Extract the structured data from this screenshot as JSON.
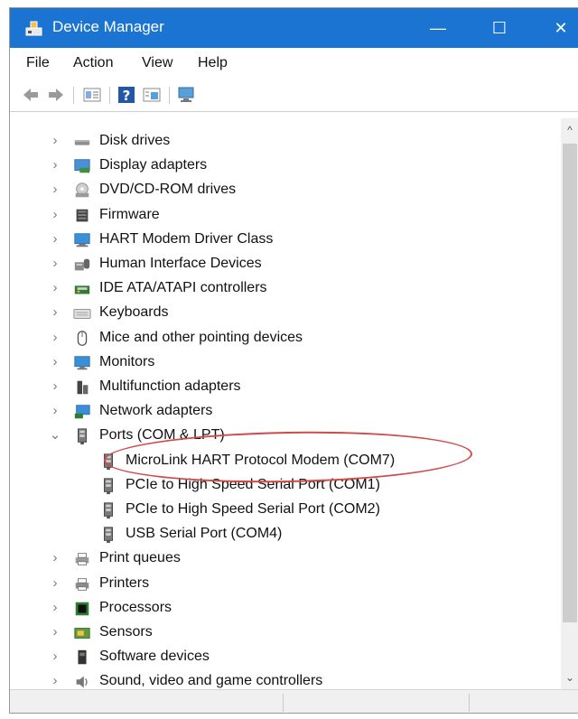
{
  "window": {
    "title": "Device Manager",
    "controls": {
      "minimize": "—",
      "maximize": "☐",
      "close": "✕"
    }
  },
  "menu": {
    "items": [
      "File",
      "Action",
      "View",
      "Help"
    ]
  },
  "toolbar": {
    "buttons": [
      "back-arrow-icon",
      "forward-arrow-icon",
      "properties-icon",
      "help-icon",
      "update-driver-icon",
      "scan-hardware-icon"
    ]
  },
  "tree": {
    "items": [
      {
        "label": "Disk drives",
        "icon": "disk-drive-icon",
        "expander": "›"
      },
      {
        "label": "Display adapters",
        "icon": "display-adapter-icon",
        "expander": "›"
      },
      {
        "label": "DVD/CD-ROM drives",
        "icon": "dvd-drive-icon",
        "expander": "›"
      },
      {
        "label": "Firmware",
        "icon": "firmware-icon",
        "expander": "›"
      },
      {
        "label": "HART Modem Driver Class",
        "icon": "hart-modem-icon",
        "expander": "›"
      },
      {
        "label": "Human Interface Devices",
        "icon": "hid-icon",
        "expander": "›"
      },
      {
        "label": "IDE ATA/ATAPI controllers",
        "icon": "ide-controller-icon",
        "expander": "›"
      },
      {
        "label": "Keyboards",
        "icon": "keyboard-icon",
        "expander": "›"
      },
      {
        "label": "Mice and other pointing devices",
        "icon": "mouse-icon",
        "expander": "›"
      },
      {
        "label": "Monitors",
        "icon": "monitor-icon",
        "expander": "›"
      },
      {
        "label": "Multifunction adapters",
        "icon": "multifunction-icon",
        "expander": "›"
      },
      {
        "label": "Network adapters",
        "icon": "network-adapter-icon",
        "expander": "›"
      },
      {
        "label": "Ports (COM & LPT)",
        "icon": "port-icon",
        "expander": "⌄",
        "expanded": true
      },
      {
        "label": "MicroLink HART Protocol Modem (COM7)",
        "icon": "port-icon",
        "child": true
      },
      {
        "label": "PCIe to High Speed Serial Port (COM1)",
        "icon": "port-icon",
        "child": true
      },
      {
        "label": "PCIe to High Speed Serial Port (COM2)",
        "icon": "port-icon",
        "child": true
      },
      {
        "label": "USB Serial Port (COM4)",
        "icon": "port-icon",
        "child": true
      },
      {
        "label": "Print queues",
        "icon": "print-queue-icon",
        "expander": "›"
      },
      {
        "label": "Printers",
        "icon": "printer-icon",
        "expander": "›"
      },
      {
        "label": "Processors",
        "icon": "processor-icon",
        "expander": "›"
      },
      {
        "label": "Sensors",
        "icon": "sensor-icon",
        "expander": "›"
      },
      {
        "label": "Software devices",
        "icon": "software-device-icon",
        "expander": "›"
      },
      {
        "label": "Sound, video and game controllers",
        "icon": "sound-icon",
        "expander": "›"
      }
    ]
  },
  "scrollbar": {
    "up": "^",
    "down": "⌄"
  },
  "colors": {
    "titlebar": "#1b74d2",
    "highlight_ellipse": "#d04a4a"
  }
}
